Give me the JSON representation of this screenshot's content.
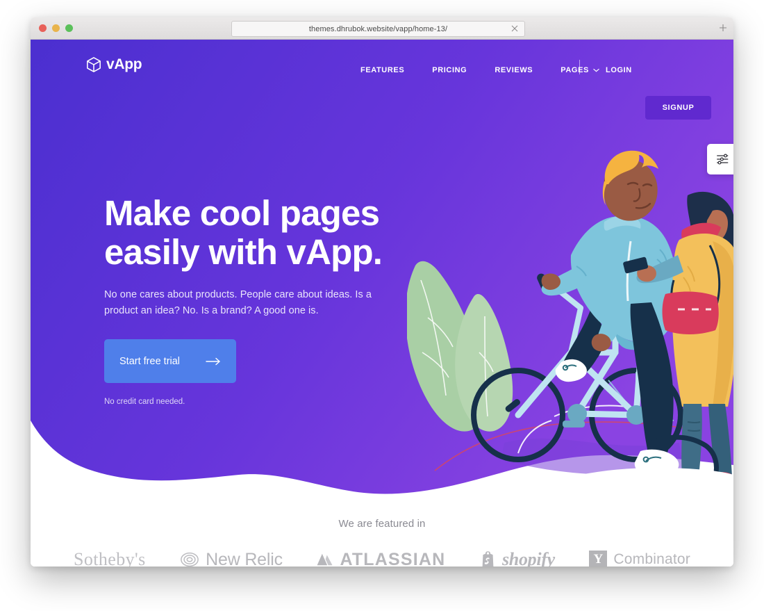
{
  "browser": {
    "url": "themes.dhrubok.website/vapp/home-13/",
    "close_icon": "close-icon",
    "new_tab_icon": "plus-icon",
    "traffic_lights": [
      "close-red",
      "minimize-yellow",
      "maximize-green"
    ]
  },
  "nav": {
    "brand": "vApp",
    "brand_icon": "cube-icon",
    "links": [
      {
        "label": "FEATURES"
      },
      {
        "label": "PRICING"
      },
      {
        "label": "REVIEWS"
      },
      {
        "label": "PAGES",
        "caret_icon": "chevron-down-icon"
      }
    ],
    "login_label": "LOGIN",
    "signup_label": "SIGNUP"
  },
  "hero": {
    "title_line_1": "Make cool pages",
    "title_line_2": "easily with vApp.",
    "subtitle": "No one cares about products. People care about ideas. Is a product an idea? No. Is a brand? A good one is.",
    "cta_label": "Start free trial",
    "cta_icon": "arrow-right-icon",
    "cta_note": "No credit card needed."
  },
  "settings": {
    "icon": "sliders-icon"
  },
  "featured": {
    "title": "We are featured in",
    "logos": [
      {
        "name": "Sotheby's",
        "mark": "none"
      },
      {
        "name": "New Relic",
        "mark": "concentric-circles-icon"
      },
      {
        "name": "ATLASSIAN",
        "mark": "atlassian-triangle-icon"
      },
      {
        "name": "shopify",
        "mark": "shopping-bag-icon"
      },
      {
        "name": "Combinator",
        "mark": "Y"
      }
    ]
  },
  "colors": {
    "hero_gradient_start": "#4b2fd0",
    "hero_gradient_end": "#8341e0",
    "signup_button": "#6029cf",
    "cta_button": "#4f7fea",
    "nav_text": "#ffffff",
    "featured_text": "#8a8a92",
    "logo_gray": "#b4b4b8",
    "illustration_jacket": "#7ec5dc",
    "illustration_hair": "#f5b340",
    "illustration_skin": "#9a5b44",
    "illustration_pants": "#16304a",
    "illustration_plant": "#a8cfa3",
    "illustration_coat": "#f3c05b",
    "illustration_bag": "#d93b5c",
    "illustration_jeans": "#3f6d87"
  }
}
